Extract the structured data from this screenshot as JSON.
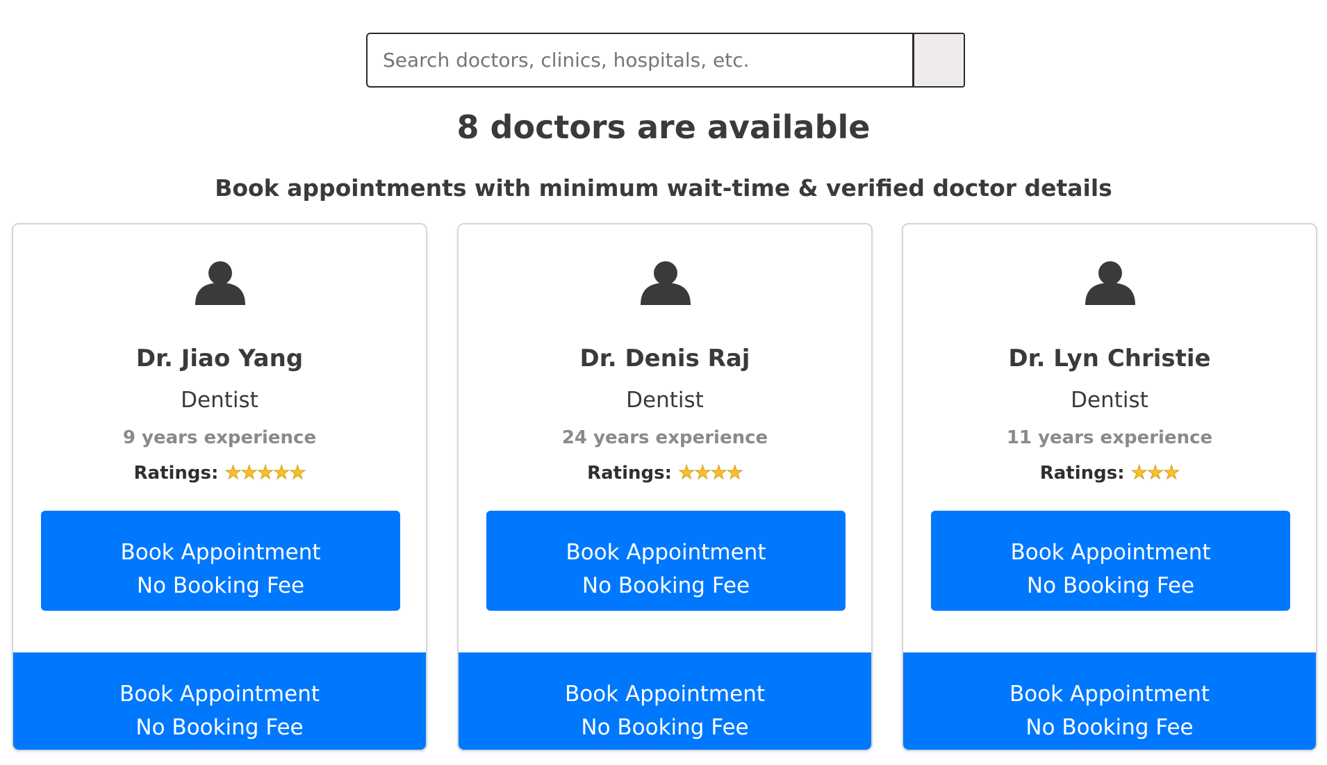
{
  "search": {
    "placeholder": "Search doctors, clinics, hospitals, etc."
  },
  "header": {
    "title": "8 doctors are available",
    "subtitle": "Book appointments with minimum wait-time & verified doctor details"
  },
  "colors": {
    "primary_button": "#0078fe",
    "text_dark": "#3a3a3a",
    "text_muted": "#8a8a8a",
    "star": "#f6c02e"
  },
  "doctors": [
    {
      "name": "Dr. Jiao Yang",
      "specialty": "Dentist",
      "experience": "9 years experience",
      "ratings_label": "Ratings:",
      "rating": 5,
      "stars": "★★★★★",
      "book_line1": "Book Appointment",
      "book_line2": "No Booking Fee",
      "footer_line1": "Book Appointment",
      "footer_line2": "No Booking Fee"
    },
    {
      "name": "Dr. Denis Raj",
      "specialty": "Dentist",
      "experience": "24 years experience",
      "ratings_label": "Ratings:",
      "rating": 4,
      "stars": "★★★★",
      "book_line1": "Book Appointment",
      "book_line2": "No Booking Fee",
      "footer_line1": "Book Appointment",
      "footer_line2": "No Booking Fee"
    },
    {
      "name": "Dr. Lyn Christie",
      "specialty": "Dentist",
      "experience": "11 years experience",
      "ratings_label": "Ratings:",
      "rating": 3,
      "stars": "★★★",
      "book_line1": "Book Appointment",
      "book_line2": "No Booking Fee",
      "footer_line1": "Book Appointment",
      "footer_line2": "No Booking Fee"
    }
  ]
}
